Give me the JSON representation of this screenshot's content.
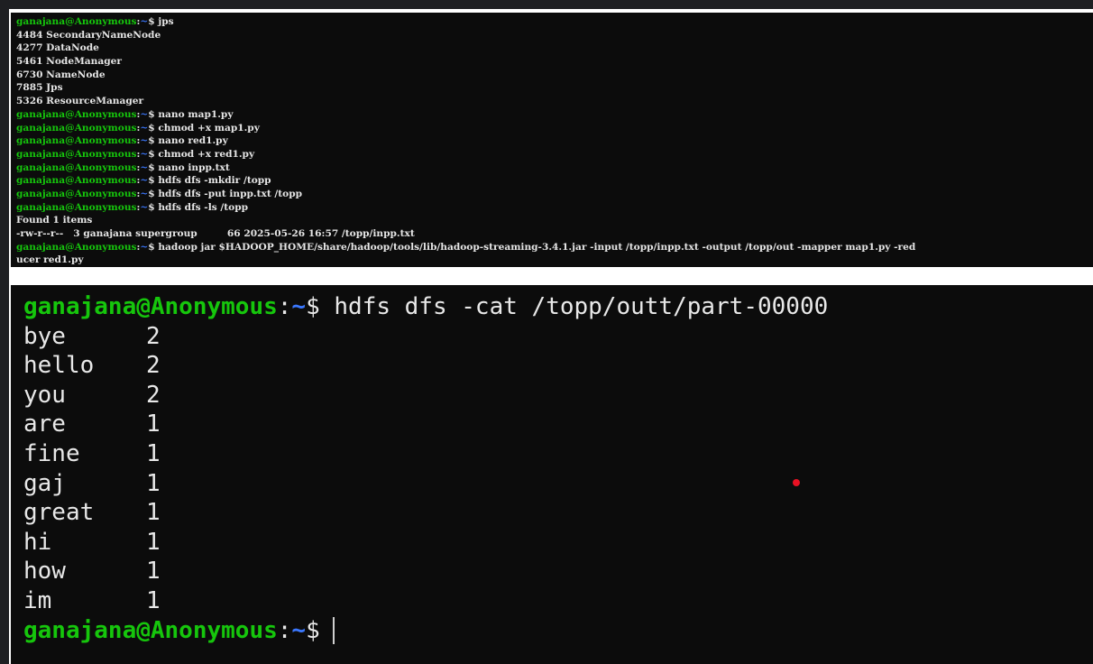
{
  "prompt": {
    "user": "ganajana@Anonymous",
    "sep": ":",
    "path": "~",
    "symbol": "$"
  },
  "top_terminal": {
    "lines": [
      {
        "type": "cmd",
        "text": " jps"
      },
      {
        "type": "out",
        "text": "4484 SecondaryNameNode"
      },
      {
        "type": "out",
        "text": "4277 DataNode"
      },
      {
        "type": "out",
        "text": "5461 NodeManager"
      },
      {
        "type": "out",
        "text": "6730 NameNode"
      },
      {
        "type": "out",
        "text": "7885 Jps"
      },
      {
        "type": "out",
        "text": "5326 ResourceManager"
      },
      {
        "type": "cmd",
        "text": " nano map1.py"
      },
      {
        "type": "cmd",
        "text": " chmod +x map1.py"
      },
      {
        "type": "cmd",
        "text": " nano red1.py"
      },
      {
        "type": "cmd",
        "text": " chmod +x red1.py"
      },
      {
        "type": "cmd",
        "text": " nano inpp.txt"
      },
      {
        "type": "cmd",
        "text": " hdfs dfs -mkdir /topp"
      },
      {
        "type": "cmd",
        "text": " hdfs dfs -put inpp.txt /topp"
      },
      {
        "type": "cmd",
        "text": " hdfs dfs -ls /topp"
      },
      {
        "type": "out",
        "text": "Found 1 items"
      },
      {
        "type": "out",
        "text": "-rw-r--r--   3 ganajana supergroup         66 2025-05-26 16:57 /topp/inpp.txt"
      },
      {
        "type": "cmd",
        "text": " hadoop jar $HADOOP_HOME/share/hadoop/tools/lib/hadoop-streaming-3.4.1.jar -input /topp/inpp.txt -output /topp/out -mapper map1.py -red"
      },
      {
        "type": "out",
        "text": "ucer red1.py"
      }
    ]
  },
  "bottom_terminal": {
    "command": " hdfs dfs -cat /topp/outt/part-00000",
    "results": [
      {
        "word": "bye",
        "count": "2"
      },
      {
        "word": "hello",
        "count": "2"
      },
      {
        "word": "you",
        "count": "2"
      },
      {
        "word": "are",
        "count": "1"
      },
      {
        "word": "fine",
        "count": "1"
      },
      {
        "word": "gaj",
        "count": "1"
      },
      {
        "word": "great",
        "count": "1"
      },
      {
        "word": "hi",
        "count": "1"
      },
      {
        "word": "how",
        "count": "1"
      },
      {
        "word": "im",
        "count": "1"
      }
    ]
  }
}
